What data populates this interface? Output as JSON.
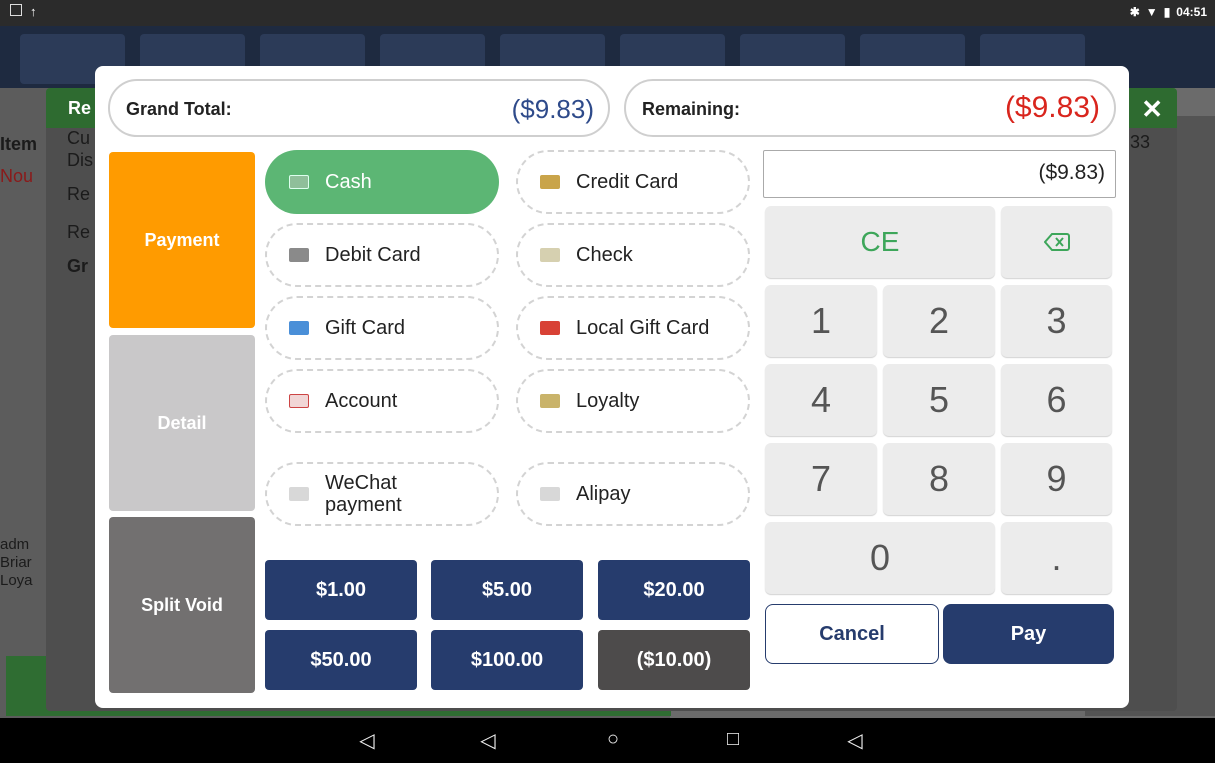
{
  "statusbar": {
    "time": "04:51"
  },
  "background": {
    "side_lines": [
      "Item",
      "Cu",
      "Dis",
      "Re",
      "Re",
      "Gr",
      "Nou",
      "adm",
      "Briar",
      "Loya"
    ],
    "right_value": "33",
    "dialog_title": "Re",
    "close_glyph": "✕"
  },
  "header": {
    "grand_total_label": "Grand Total:",
    "grand_total_value": "($9.83)",
    "remaining_label": "Remaining:",
    "remaining_value": "($9.83)"
  },
  "tabs": [
    {
      "label": "Payment",
      "color": "#ff9b00"
    },
    {
      "label": "Detail",
      "color": "#c9c8c9"
    },
    {
      "label": "Split Void",
      "color": "#727070"
    }
  ],
  "payment_methods": [
    {
      "label": "Cash",
      "icon": "cash-icon",
      "active": true
    },
    {
      "label": "Credit Card",
      "icon": "credit-card-icon"
    },
    {
      "label": "Debit Card",
      "icon": "debit-card-icon"
    },
    {
      "label": "Check",
      "icon": "check-icon"
    },
    {
      "label": "Gift Card",
      "icon": "gift-card-icon"
    },
    {
      "label": "Local Gift Card",
      "icon": "local-gift-card-icon"
    },
    {
      "label": "Account",
      "icon": "account-icon"
    },
    {
      "label": "Loyalty",
      "icon": "loyalty-icon"
    },
    {
      "label": "WeChat payment",
      "icon": "wechat-icon"
    },
    {
      "label": "Alipay",
      "icon": "alipay-icon"
    }
  ],
  "quick_amounts": [
    "$1.00",
    "$5.00",
    "$20.00",
    "$50.00",
    "$100.00",
    "($10.00)"
  ],
  "keypad": {
    "display_value": "($9.83)",
    "clear_label": "CE",
    "backspace_icon": "backspace-icon",
    "keys": [
      "1",
      "2",
      "3",
      "4",
      "5",
      "6",
      "7",
      "8",
      "9",
      "0",
      "."
    ]
  },
  "actions": {
    "cancel_label": "Cancel",
    "pay_label": "Pay"
  },
  "colors": {
    "accent_navy": "#263c6d",
    "cash_green": "#5cb674",
    "remaining_red": "#d9251d",
    "grand_total_blue": "#2e4a8a"
  }
}
